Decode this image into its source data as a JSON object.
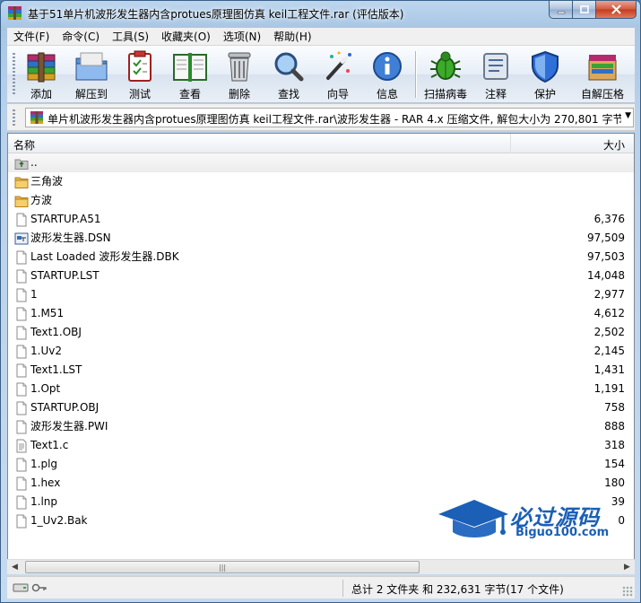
{
  "window": {
    "title": "基于51单片机波形发生器内含protues原理图仿真 keil工程文件.rar (评估版本)"
  },
  "menu": [
    "文件(F)",
    "命令(C)",
    "工具(S)",
    "收藏夹(O)",
    "选项(N)",
    "帮助(H)"
  ],
  "toolbar": {
    "add": "添加",
    "extract": "解压到",
    "test": "测试",
    "view": "查看",
    "delete": "删除",
    "find": "查找",
    "wizard": "向导",
    "info": "信息",
    "virus_scan": "扫描病毒",
    "comment": "注释",
    "protect": "保护",
    "sfx": "自解压格"
  },
  "address": {
    "path": "单片机波形发生器内含protues原理图仿真 keil工程文件.rar\\波形发生器 - RAR 4.x 压缩文件, 解包大小为 270,801 字节"
  },
  "list": {
    "col_name": "名称",
    "col_size": "大小",
    "rows": [
      {
        "name": "..",
        "size": "",
        "type": "up"
      },
      {
        "name": "三角波",
        "size": "",
        "type": "folder"
      },
      {
        "name": "方波",
        "size": "",
        "type": "folder"
      },
      {
        "name": "STARTUP.A51",
        "size": "6,376",
        "type": "file"
      },
      {
        "name": "波形发生器.DSN",
        "size": "97,509",
        "type": "dsn"
      },
      {
        "name": "Last Loaded 波形发生器.DBK",
        "size": "97,503",
        "type": "file"
      },
      {
        "name": "STARTUP.LST",
        "size": "14,048",
        "type": "file"
      },
      {
        "name": "1",
        "size": "2,977",
        "type": "file"
      },
      {
        "name": "1.M51",
        "size": "4,612",
        "type": "file"
      },
      {
        "name": "Text1.OBJ",
        "size": "2,502",
        "type": "file"
      },
      {
        "name": "1.Uv2",
        "size": "2,145",
        "type": "file"
      },
      {
        "name": "Text1.LST",
        "size": "1,431",
        "type": "file"
      },
      {
        "name": "1.Opt",
        "size": "1,191",
        "type": "file"
      },
      {
        "name": "STARTUP.OBJ",
        "size": "758",
        "type": "file"
      },
      {
        "name": "波形发生器.PWI",
        "size": "888",
        "type": "file"
      },
      {
        "name": "Text1.c",
        "size": "318",
        "type": "text"
      },
      {
        "name": "1.plg",
        "size": "154",
        "type": "file"
      },
      {
        "name": "1.hex",
        "size": "180",
        "type": "file"
      },
      {
        "name": "1.lnp",
        "size": "39",
        "type": "file"
      },
      {
        "name": "1_Uv2.Bak",
        "size": "0",
        "type": "file"
      }
    ]
  },
  "watermark": {
    "cn": "必过源码",
    "en": "Biguo100.com"
  },
  "status": {
    "summary": "总计 2 文件夹 和 232,631 字节(17 个文件)"
  },
  "colors": {
    "accent": "#1b5fb6",
    "folder": "#e8b84a",
    "close": "#c33b20"
  }
}
